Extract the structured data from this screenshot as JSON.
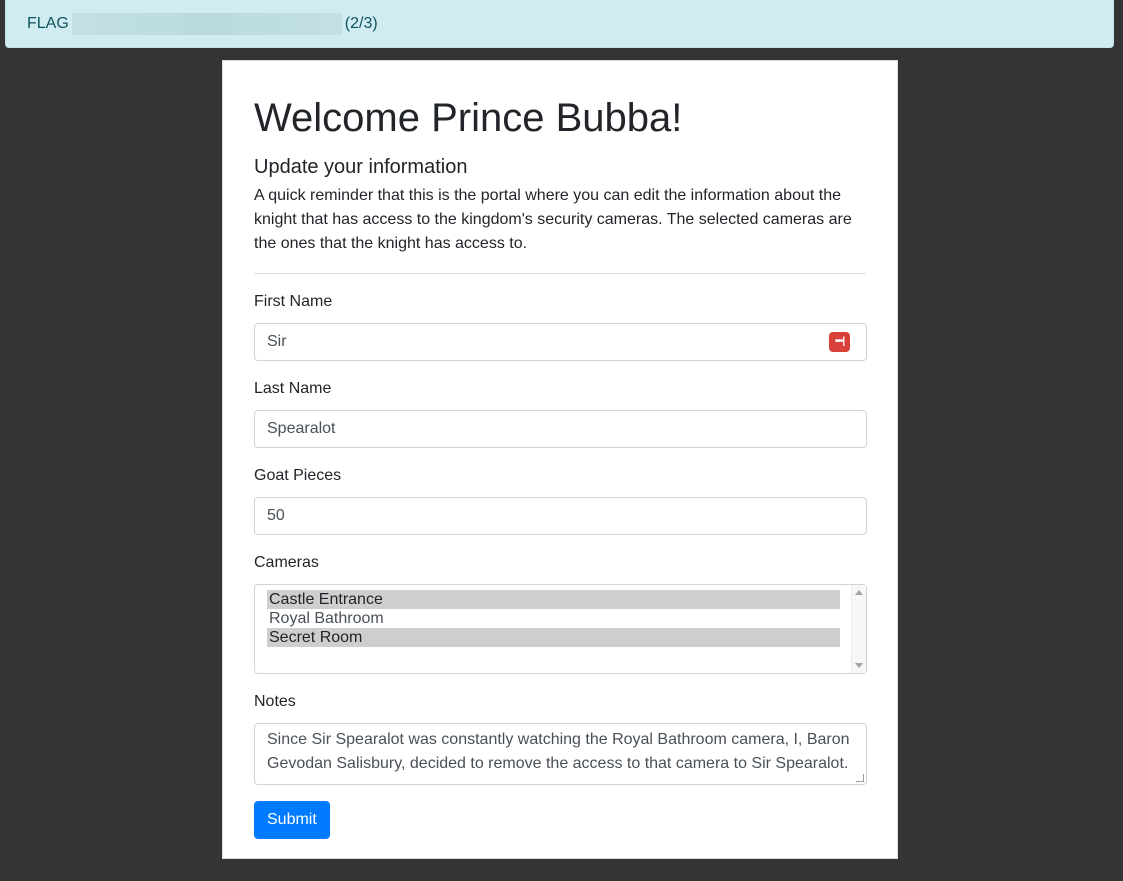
{
  "banner": {
    "prefix": "FLAG",
    "suffix": "(2/3)"
  },
  "page": {
    "title": "Welcome Prince Bubba!",
    "subtitle": "Update your information",
    "intro": "A quick reminder that this is the portal where you can edit the information about the knight that has access to the kingdom's security cameras. The selected cameras are the ones that the knight has access to."
  },
  "form": {
    "first_name": {
      "label": "First Name",
      "value": "Sir"
    },
    "last_name": {
      "label": "Last Name",
      "value": "Spearalot"
    },
    "goat_pieces": {
      "label": "Goat Pieces",
      "value": "50"
    },
    "cameras": {
      "label": "Cameras",
      "options": [
        {
          "label": "Castle Entrance",
          "selected": true
        },
        {
          "label": "Royal Bathroom",
          "selected": false
        },
        {
          "label": "Secret Room",
          "selected": true
        }
      ]
    },
    "notes": {
      "label": "Notes",
      "value": "Since Sir Spearalot was constantly watching the Royal Bathroom camera, I, Baron Gevodan Salisbury, decided to remove the access to that camera to Sir Spearalot."
    },
    "submit_label": "Submit"
  },
  "icons": {
    "password_manager": "password-manager-icon"
  },
  "colors": {
    "banner_bg": "#d1ecf1",
    "banner_text": "#0c5460",
    "page_bg": "#343434",
    "primary": "#007bff",
    "selected_option": "#cecece",
    "password_icon": "#d9403a"
  }
}
